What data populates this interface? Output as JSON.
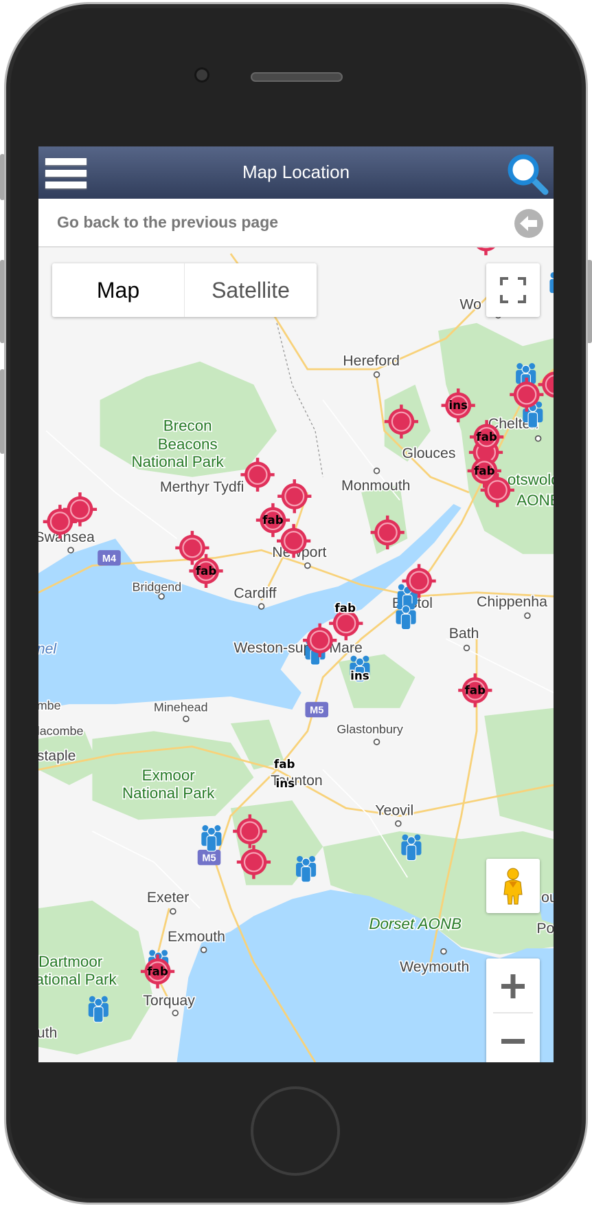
{
  "header": {
    "title": "Map Location",
    "menu_icon": "hamburger-icon",
    "search_icon": "magnifier-icon"
  },
  "back_bar": {
    "label": "Go back to the previous page",
    "icon": "arrow-left-circle-icon"
  },
  "map_controls": {
    "map_type": {
      "options": [
        "Map",
        "Satellite"
      ],
      "selected": "Map"
    },
    "fullscreen_icon": "fullscreen-icon",
    "pegman_icon": "street-view-pegman-icon",
    "zoom_in": "+",
    "zoom_out": "−"
  },
  "map": {
    "colors": {
      "water": "#aadaff",
      "land": "#f5f5f5",
      "park": "#c8e8c0",
      "road": "#f8d27a",
      "marker": "#e0305a",
      "people": "#2a8ad6"
    },
    "places": [
      "Wo",
      "Hereford",
      "Chelten",
      "Brecon",
      "Beacons",
      "National Park",
      "Glouces",
      "Merthyr Tydfi",
      "Monmouth",
      "otswold",
      "AONB",
      "Swansea",
      "Newport",
      "Bridgend",
      "Cardiff",
      "Bristol",
      "Chippenha",
      "Bath",
      "Weston-super-Mare",
      "nel",
      "mbe",
      "Minehead",
      "lacombe",
      "Glastonbury",
      "staple",
      "Exmoor",
      "National Park",
      "Taunton",
      "Yeovil",
      "Exeter",
      "ou",
      "Exmouth",
      "Dorset AONB",
      "Po",
      "Dartmoor",
      "ational Park",
      "Weymouth",
      "Torquay",
      "uth"
    ],
    "roads": [
      "M4",
      "M5",
      "M5"
    ],
    "marker_labels": {
      "fab": "fab",
      "ins": "ins"
    }
  }
}
